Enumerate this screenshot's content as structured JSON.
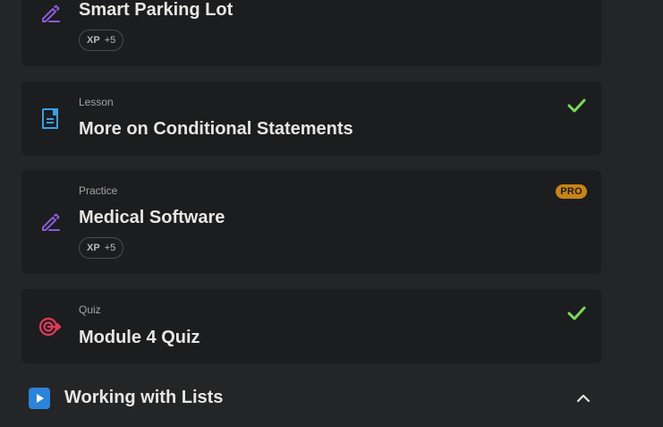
{
  "items": [
    {
      "type": "",
      "title": "Smart Parking Lot",
      "icon": "pencil-practice-icon",
      "xp_label": "XP",
      "xp_value": "+5",
      "completed": false,
      "pro": false
    },
    {
      "type": "Lesson",
      "title": "More on Conditional Statements",
      "icon": "lesson-document-icon",
      "completed": true,
      "pro": false
    },
    {
      "type": "Practice",
      "title": "Medical Software",
      "icon": "pencil-practice-icon",
      "xp_label": "XP",
      "xp_value": "+5",
      "completed": false,
      "pro": true,
      "pro_label": "PRO"
    },
    {
      "type": "Quiz",
      "title": "Module 4 Quiz",
      "icon": "quiz-target-icon",
      "completed": true,
      "pro": false
    }
  ],
  "section": {
    "title": "Working with Lists",
    "icon": "play-icon",
    "expanded": true
  },
  "colors": {
    "background": "#242527",
    "card": "#1c1d1f",
    "practice_icon": "#8b5bd8",
    "lesson_icon": "#3b9fe6",
    "quiz_icon": "#e23a5b",
    "check": "#7ed957",
    "pro_badge": "#c98317",
    "section_play": "#2b84d9"
  }
}
